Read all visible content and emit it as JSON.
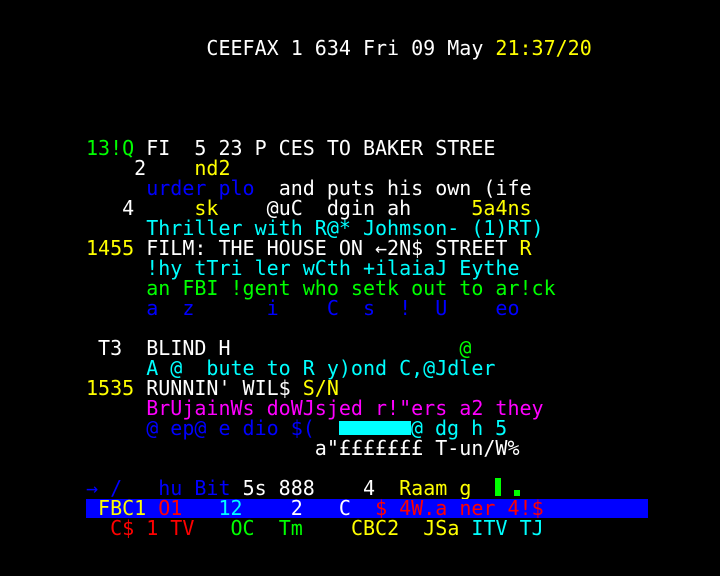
{
  "colors": {
    "white": "#ffffff",
    "yellow": "#ffff00",
    "green": "#00ff00",
    "cyan": "#00ffff",
    "blue": "#0000ff",
    "magenta": "#ff00ff",
    "red": "#ff0000",
    "background": "#000000"
  },
  "header": {
    "service": "CEEFAX 1 634 Fri 09 May",
    "time": "21:37/20"
  },
  "listings": {
    "l1_time": "13!Q",
    "l1_title": "FI  5 23 P CES TO BAKER STREE",
    "l2_a": "2",
    "l2_b": "nd2",
    "l3_a": "urder plo",
    "l3_b": "and puts his own (ife",
    "l4_a": "4",
    "l4_b": "sk",
    "l4_c": "@uC  dgin ah",
    "l4_d": "5a4ns",
    "l5": "Thriller with R@* Johmson- (1)RT)",
    "l6_time": "1455",
    "l6_title": "FILM: THE HOUSE ON ←2N$ STREET",
    "l6_suffix": "R",
    "l7": "!hy tTri ler wCth +ilaiaJ Eythe",
    "l8": "an FBI !gent who setk out to ar!ck",
    "l9": "a  z      i    C  s  !  U    eo",
    "l10_code": "T3",
    "l10_title": "BLIND H",
    "l10_at": "@",
    "l11": "A @  bute to R y)ond C,@Jdler",
    "l12_time": "1535",
    "l12_title": "RUNNIN' WIL$",
    "l12_suffix": "S/N",
    "l13": "BrUjainWs doWJsjed r!\"ers a2 they",
    "l14_a": "@ ep@ e dio $(",
    "l14_b": "@ dg h 5",
    "l15": "a\"£££££££ T-un/W%"
  },
  "index": {
    "arrow": "→",
    "slash": "/",
    "hu_bit": "hu Bit",
    "fives": "5s 888",
    "four": "4",
    "raam": "Raam g"
  },
  "fastext": {
    "fbc1": "FBC1",
    "o1": "O1",
    "twelve": "12",
    "two": "2",
    "c": "C",
    "dollar4w": "$ 4W.a ner 4!$"
  },
  "channels": {
    "c1": "C$ 1 TV",
    "oc": "OC",
    "tm": "Tm",
    "cbc2": "CBC2",
    "jsa": "JSa",
    "itv": "ITV",
    "tj": "TJ"
  }
}
